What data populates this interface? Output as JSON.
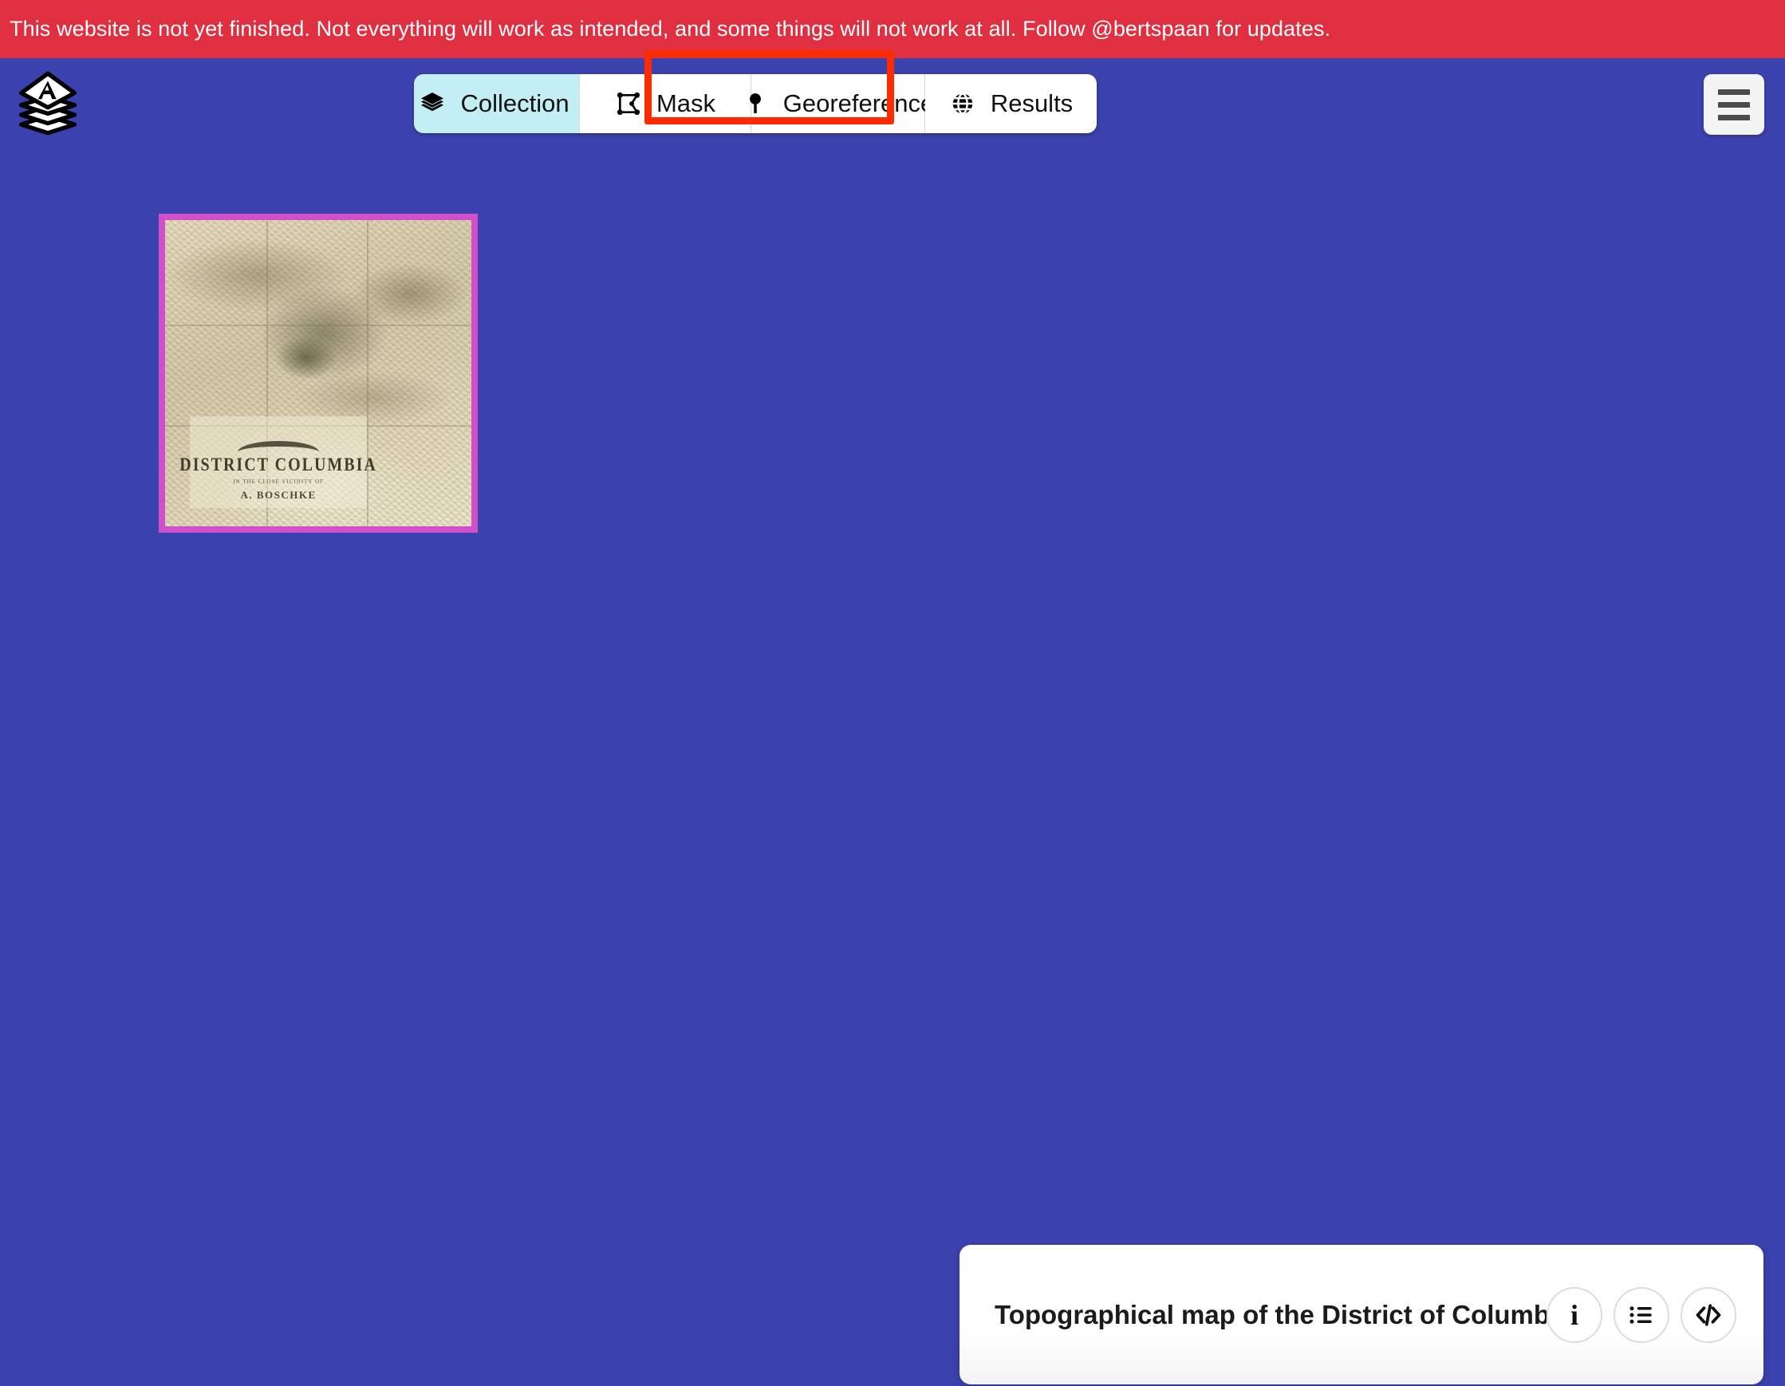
{
  "notice": {
    "text": "This website is not yet finished. Not everything will work as intended, and some things will not work at all. Follow @bertspaan for updates.",
    "background_color": "#e02f41",
    "text_color": "#ffffff"
  },
  "theme": {
    "background_color": "#3b42ad",
    "active_tab_color": "#c3eef3",
    "highlight_color": "#ff2b00",
    "thumbnail_border_color": "#d14fca"
  },
  "header": {
    "logo_name": "allmaps-logo",
    "logo_letter": "A",
    "menu_button_label": "Menu",
    "menu_icon": "hamburger-icon"
  },
  "nav": {
    "tabs": [
      {
        "id": "collection",
        "label": "Collection",
        "icon": "layers-icon",
        "active": true,
        "highlighted": false
      },
      {
        "id": "mask",
        "label": "Mask",
        "icon": "mask-icon",
        "active": false,
        "highlighted": true
      },
      {
        "id": "georeference",
        "label": "Georeference",
        "icon": "pin-icon",
        "active": false,
        "highlighted": false
      },
      {
        "id": "results",
        "label": "Results",
        "icon": "globe-icon",
        "active": false,
        "highlighted": false
      }
    ]
  },
  "main": {
    "thumbnail": {
      "name": "map-thumbnail",
      "alt": "Topographical map of the District of Columbia",
      "cartouche": {
        "title": "DISTRICT COLUMBIA",
        "subtitle": "IN THE CLOSE VICINITY OF",
        "author": "A. BOSCHKE"
      }
    }
  },
  "info_card": {
    "title": "Topographical map of the District of Columbia",
    "actions": [
      {
        "id": "info",
        "icon": "info-icon",
        "label": "i"
      },
      {
        "id": "metadata",
        "icon": "list-icon",
        "label": ""
      },
      {
        "id": "code",
        "icon": "code-icon",
        "label": ""
      }
    ]
  }
}
